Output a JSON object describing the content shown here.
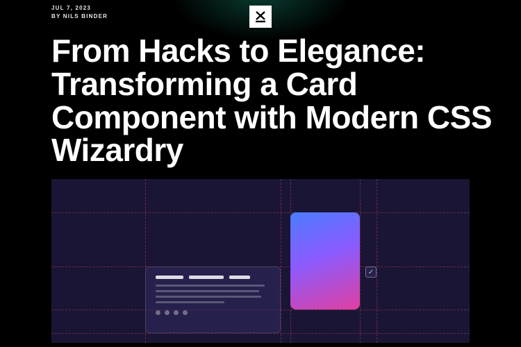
{
  "meta": {
    "date": "JUL 7, 2023",
    "byline": "BY NILS BINDER"
  },
  "title": "From Hacks to Elegance: Transforming a Card Component with Modern CSS Wizardry",
  "logo_icon": "x-underline"
}
